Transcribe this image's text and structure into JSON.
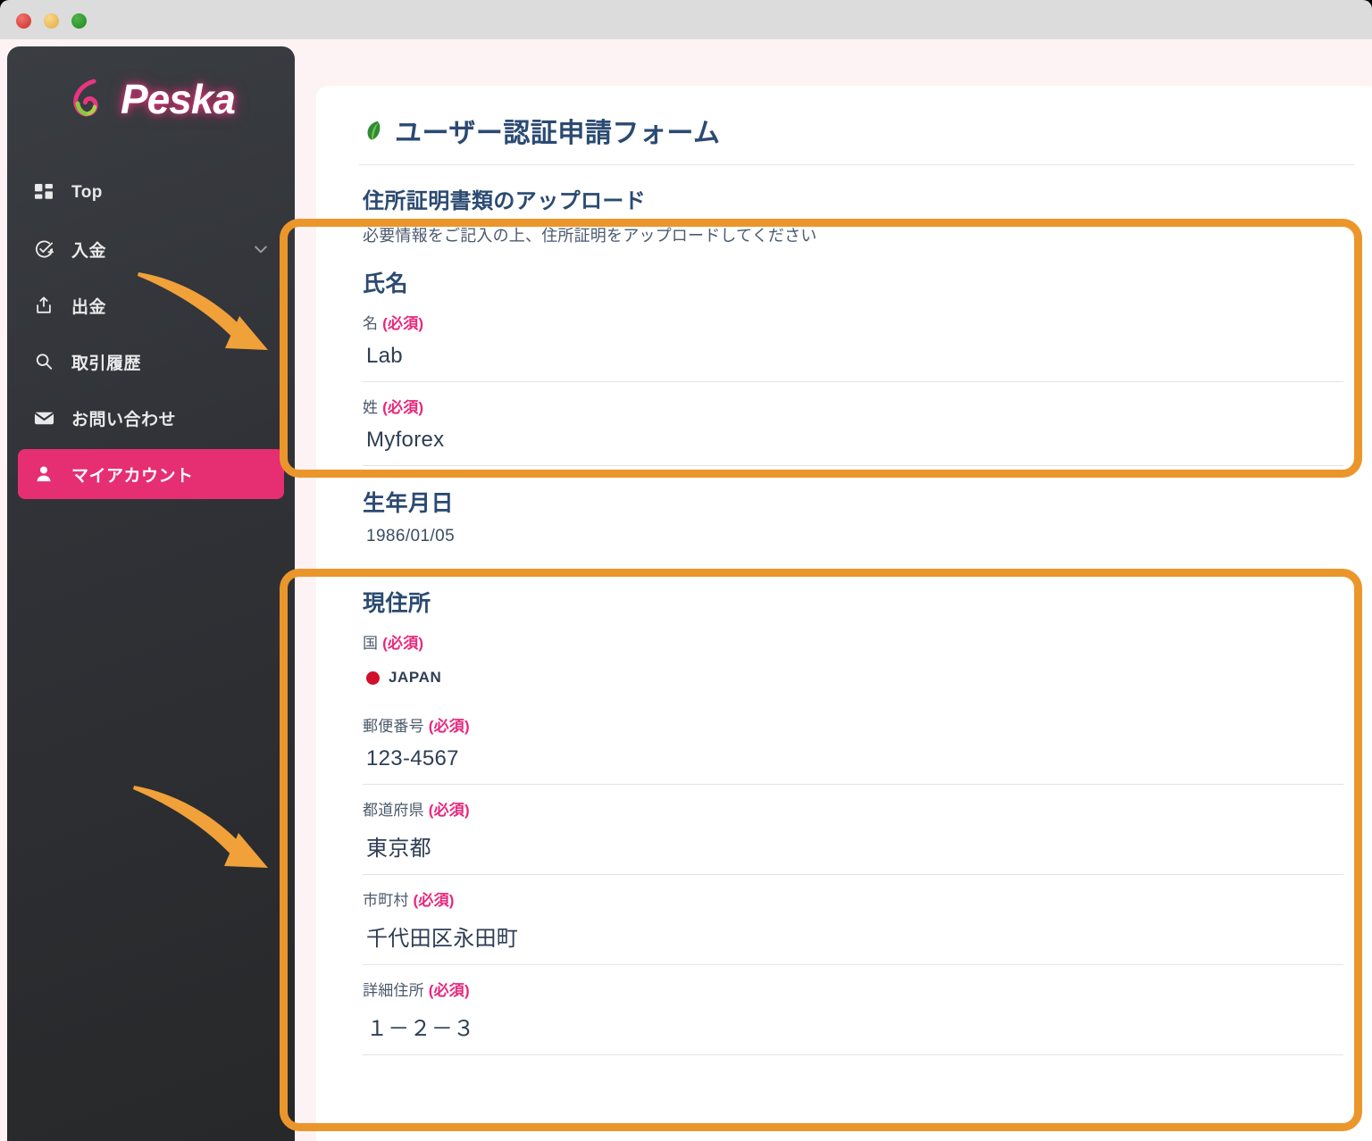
{
  "window": {
    "traffic_lights": [
      "close",
      "minimize",
      "maximize"
    ]
  },
  "brand": {
    "name": "Peska",
    "mark_icon": "peach-swirl-icon"
  },
  "sidebar": {
    "items": [
      {
        "label": "Top",
        "icon": "grid-dashboard-icon",
        "active": false,
        "chevron": false
      },
      {
        "label": "入金",
        "icon": "circle-check-plus-icon",
        "active": false,
        "chevron": true
      },
      {
        "label": "出金",
        "icon": "upload-box-icon",
        "active": false,
        "chevron": false
      },
      {
        "label": "取引履歴",
        "icon": "search-icon",
        "active": false,
        "chevron": false
      },
      {
        "label": "お問い合わせ",
        "icon": "envelope-icon",
        "active": false,
        "chevron": false
      },
      {
        "label": "マイアカウント",
        "icon": "user-person-icon",
        "active": true,
        "chevron": false
      }
    ],
    "active_color": "#e62e73"
  },
  "page": {
    "title": "ユーザー認証申請フォーム",
    "title_icon": "leaf-icon",
    "section_heading": "住所証明書類のアップロード",
    "section_description": "必要情報をご記入の上、住所証明をアップロードしてください"
  },
  "form": {
    "name_group": {
      "title": "氏名",
      "fields": [
        {
          "label": "名",
          "required_tag": "(必須)",
          "value": "Lab"
        },
        {
          "label": "姓",
          "required_tag": "(必須)",
          "value": "Myforex"
        }
      ]
    },
    "dob_group": {
      "title": "生年月日",
      "value": "1986/01/05"
    },
    "address_group": {
      "title": "現住所",
      "country": {
        "label": "国",
        "required_tag": "(必須)",
        "value": "JAPAN",
        "flag_icon": "japan-flag-icon"
      },
      "fields": [
        {
          "label": "郵便番号",
          "required_tag": "(必須)",
          "value": "123-4567"
        },
        {
          "label": "都道府県",
          "required_tag": "(必須)",
          "value": "東京都"
        },
        {
          "label": "市町村",
          "required_tag": "(必須)",
          "value": "千代田区永田町"
        },
        {
          "label": "詳細住所",
          "required_tag": "(必須)",
          "value": "１－２－３"
        }
      ]
    }
  },
  "annotations": {
    "color": "#eb962b",
    "highlight_boxes": [
      {
        "name": "name-section-highlight"
      },
      {
        "name": "address-section-highlight"
      }
    ],
    "arrows": [
      {
        "name": "arrow-to-name-section"
      },
      {
        "name": "arrow-to-address-section"
      }
    ]
  }
}
